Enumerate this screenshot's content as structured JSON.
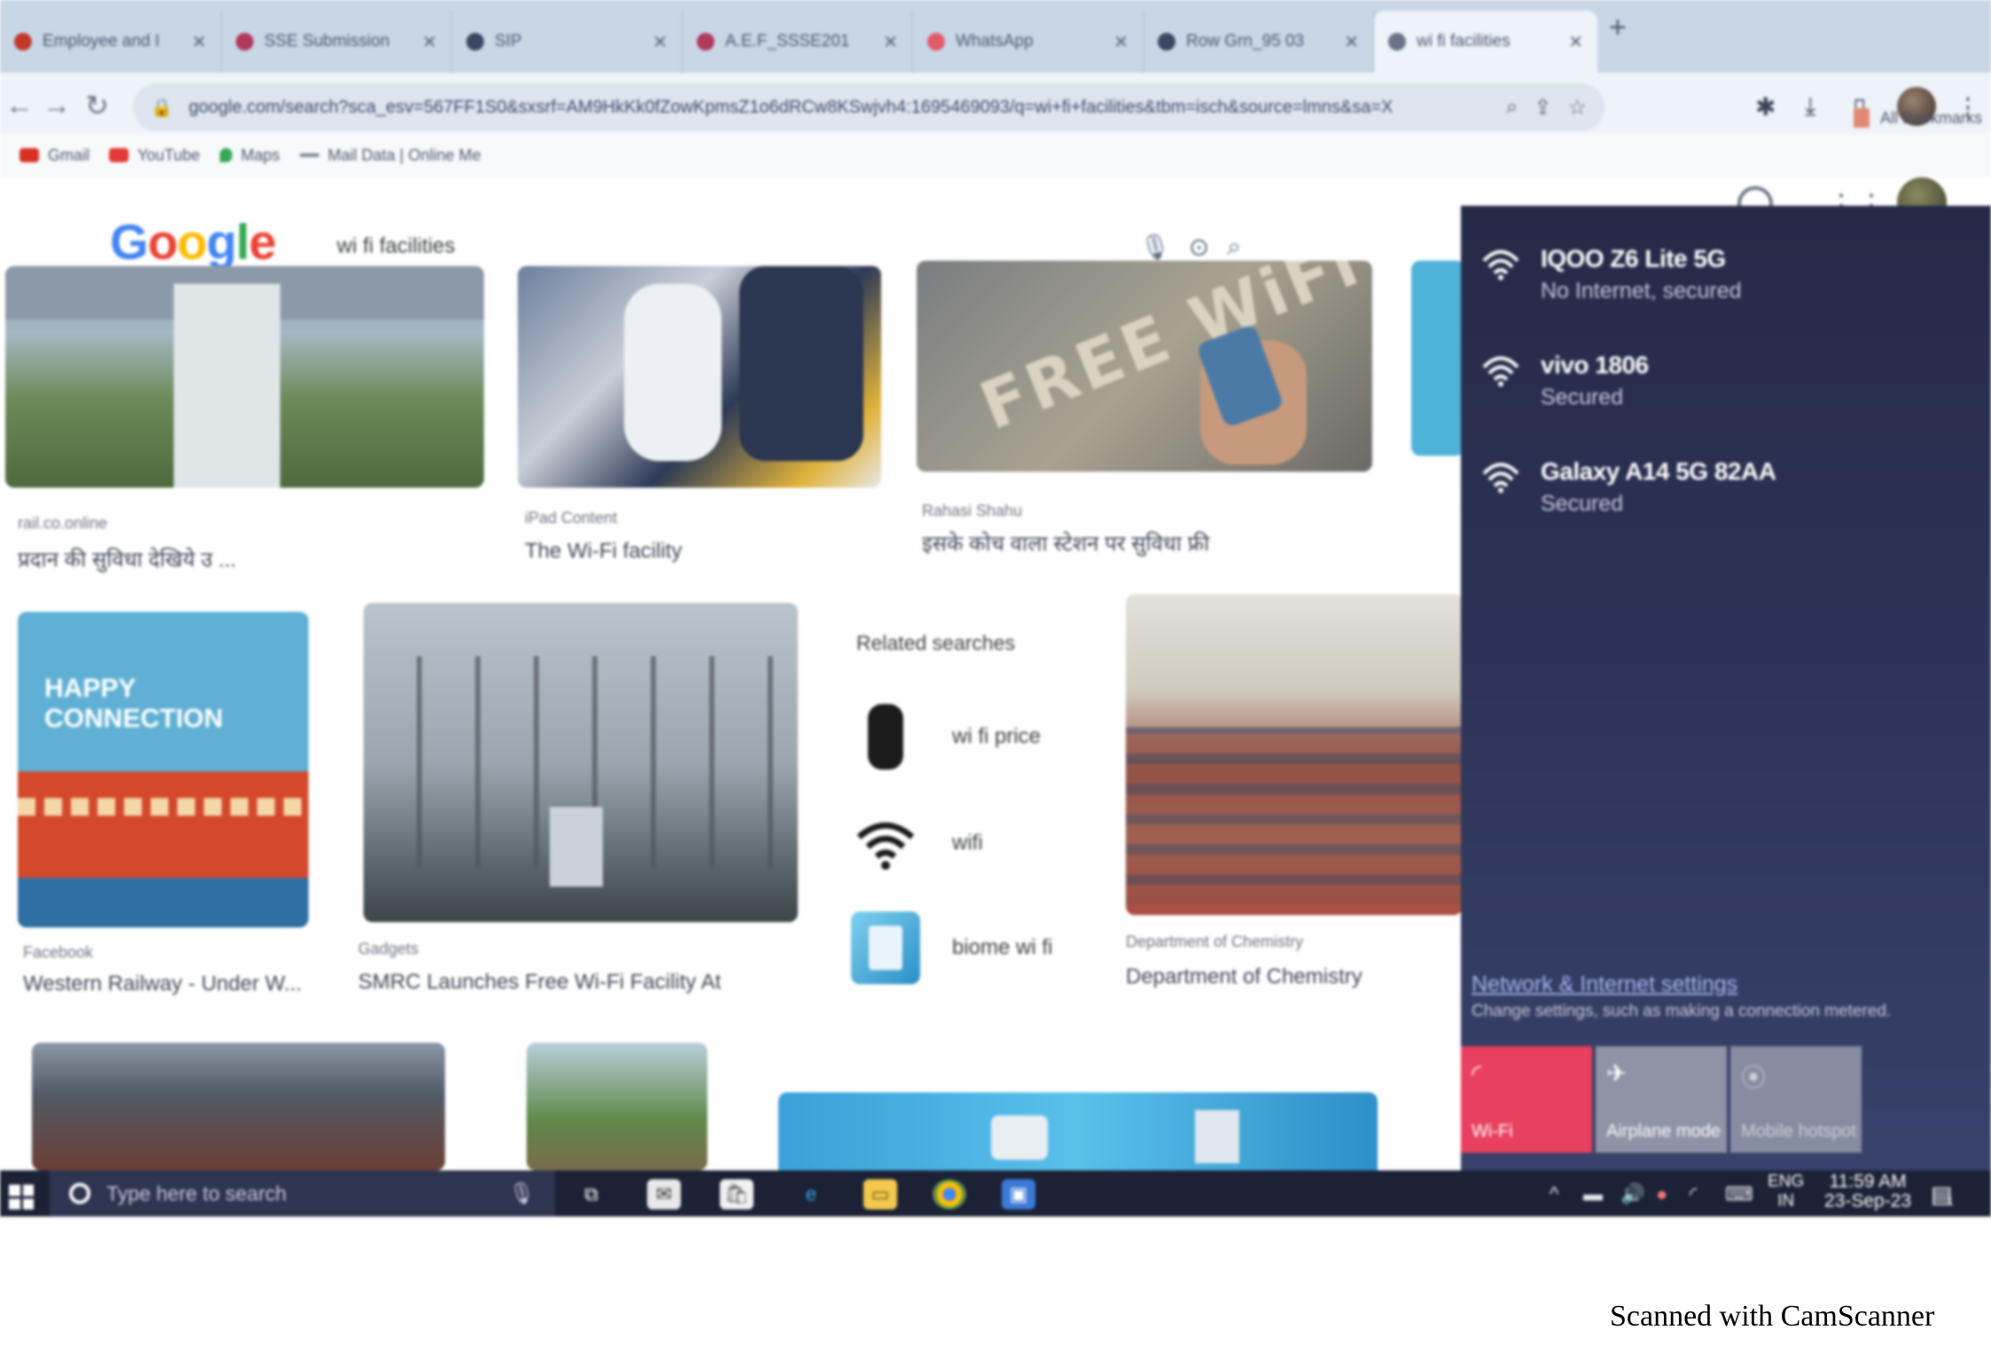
{
  "browser": {
    "tabs": [
      {
        "title": "Employee and I",
        "favicon_color": "#c0392b"
      },
      {
        "title": "SSE Submission",
        "favicon_color": "#b03a5b"
      },
      {
        "title": "SIP",
        "favicon_color": "#3b4660"
      },
      {
        "title": "A.E.F_SSSE201",
        "favicon_color": "#b03a5b"
      },
      {
        "title": "WhatsApp",
        "favicon_color": "#e05a6a"
      },
      {
        "title": "Row Grn_95 03",
        "favicon_color": "#3b4660"
      },
      {
        "title": "wi fi facilities",
        "favicon_color": "#6b7486",
        "active": true
      }
    ],
    "new_tab": "+",
    "url": "google.com/search?sca_esv=567FF1S0&sxsrf=AM9HkKk0fZowKpmsZ1o6dRCw8KSwjvh4:1695469093/q=wi+fi+facilities&tbm=isch&source=lmns&sa=X",
    "bookmarks": [
      {
        "label": "Gmail",
        "color": "#d93025"
      },
      {
        "label": "YouTube",
        "color": "#e53935"
      },
      {
        "label": "Maps",
        "color": "#34a853"
      },
      {
        "label": "Mail Data | Online Me",
        "color": "#7a8499"
      }
    ],
    "all_bookmarks": "All Bookmarks"
  },
  "google": {
    "logo": "Google",
    "query": "wi fi facilities"
  },
  "results": [
    {
      "source": "rail.co.online",
      "caption": "प्रदान की सुविधा देखिये उ ..."
    },
    {
      "source": "iPad Content",
      "caption": "The Wi-Fi facility"
    },
    {
      "source": "Rahasi Shahu",
      "caption": "इसके कोच वाला स्टेशन पर सुविधा फ्री"
    },
    {
      "source": "Facebook",
      "caption": "Western Railway - Under W..."
    },
    {
      "source": "Gadgets",
      "caption": "SMRC Launches Free Wi-Fi Facility At"
    },
    {
      "source": "Department of Chemistry",
      "caption": "Department of Chemistry"
    }
  ],
  "related": {
    "title": "Related searches",
    "items": [
      {
        "label": "wi fi price"
      },
      {
        "label": "wifi"
      },
      {
        "label": "biome wi fi"
      }
    ]
  },
  "network_flyout": {
    "networks": [
      {
        "name": "IQOO Z6 Lite 5G",
        "status": "No Internet, secured"
      },
      {
        "name": "vivo 1806",
        "status": "Secured"
      },
      {
        "name": "Galaxy A14 5G 82AA",
        "status": "Secured"
      }
    ],
    "settings_link": "Network & Internet settings",
    "settings_desc": "Change settings, such as making a connection metered.",
    "quick_actions": [
      {
        "label": "Wi-Fi",
        "active": true,
        "color": "#e8405e"
      },
      {
        "label": "Airplane mode",
        "active": false,
        "color": "#8e93a6"
      },
      {
        "label": "Mobile hotspot",
        "active": false,
        "color": "#a2a6b6"
      }
    ]
  },
  "taskbar": {
    "search_placeholder": "Type here to search",
    "lang_top": "ENG",
    "lang_bottom": "IN",
    "time": "11:59 AM",
    "date": "23-Sep-23",
    "notification_count": "1"
  },
  "watermark": "Scanned with CamScanner"
}
